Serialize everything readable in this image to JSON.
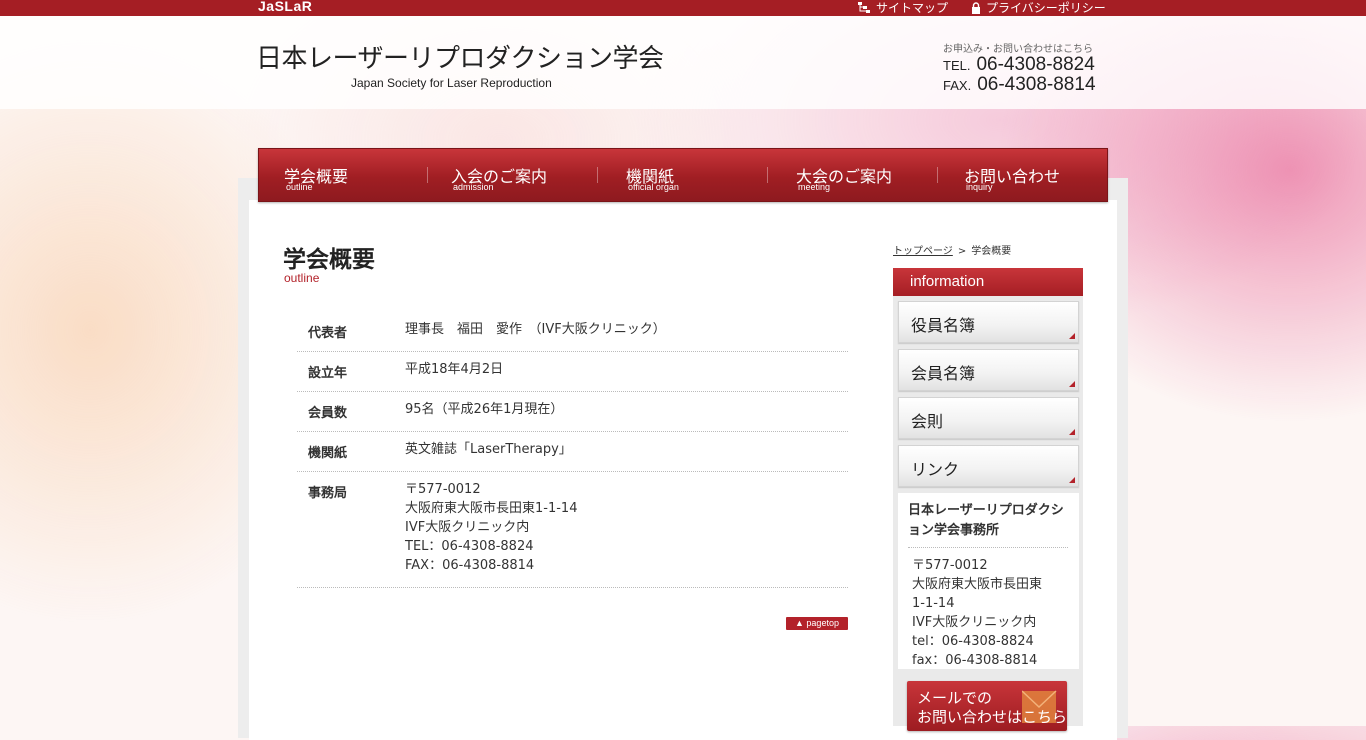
{
  "topbar": {
    "brand": "JaSLaR",
    "sitemap": "サイトマップ",
    "privacy": "プライバシーポリシー"
  },
  "header": {
    "title_jp": "日本レーザーリプロダクション学会",
    "title_en": "Japan Society for Laser Reproduction",
    "contact_note": "お申込み・お問い合わせはこちら",
    "tel_label": "TEL.",
    "tel": "06-4308-8824",
    "fax_label": "FAX.",
    "fax": "06-4308-8814"
  },
  "nav": [
    {
      "jp": "学会概要",
      "en": "outline"
    },
    {
      "jp": "入会のご案内",
      "en": "admission"
    },
    {
      "jp": "機関紙",
      "en": "official organ"
    },
    {
      "jp": "大会のご案内",
      "en": "meeting"
    },
    {
      "jp": "お問い合わせ",
      "en": "inquiry"
    }
  ],
  "page": {
    "title": "学会概要",
    "subtitle": "outline"
  },
  "info_rows": [
    {
      "key": "代表者",
      "value": "理事長　福田　愛作　（IVF大阪クリニック）"
    },
    {
      "key": "設立年",
      "value": "平成18年4月2日"
    },
    {
      "key": "会員数",
      "value": "95名（平成26年1月現在）"
    },
    {
      "key": "機関紙",
      "value": "英文雑誌「LaserTherapy」"
    },
    {
      "key": "事務局",
      "value": "〒577-0012\n大阪府東大阪市長田東1-1-14\nIVF大阪クリニック内\nTEL：06-4308-8824\nFAX：06-4308-8814"
    }
  ],
  "pagetop": "▲ pagetop",
  "breadcrumb": {
    "home": "トップページ",
    "separator": ">",
    "current": "学会概要"
  },
  "sidebar": {
    "header": "information",
    "buttons": [
      "役員名簿",
      "会員名簿",
      "会則",
      "リンク"
    ],
    "office_name": "日本レーザーリプロダクション学会事務所",
    "office_address": "〒577-0012\n大阪府東大阪市長田東\n1-1-14\nIVF大阪クリニック内\ntel：06-4308-8824\nfax：06-4308-8814",
    "mail_line1": "メールでの",
    "mail_line2": "お問い合わせはこちら"
  }
}
